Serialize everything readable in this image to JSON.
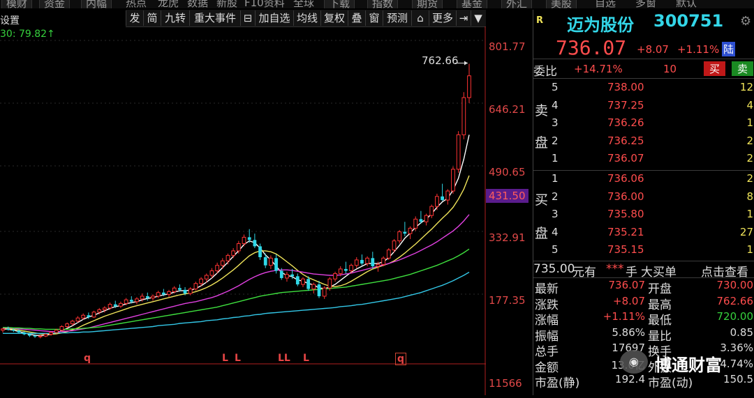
{
  "top_menu": [
    "模财",
    "资金",
    "内幅",
    "热点",
    "龙虎",
    "数据",
    "新股",
    "F10资料",
    "全球",
    "下载",
    "指数",
    "期货",
    "基金",
    "外汇",
    "美股",
    "自选",
    "多窗",
    "默认"
  ],
  "toolbar": {
    "items": [
      "发",
      "简",
      "九转",
      "重大事件",
      "⊟",
      "加自选",
      "均线",
      "复权",
      "叠",
      "窗",
      "预测",
      "⌂",
      "更多",
      "⇥",
      "▼"
    ]
  },
  "chart": {
    "indicator_text": "30: 79.82↑",
    "setting_text": "设置",
    "peak_label": "762.66",
    "axis_labels": [
      "801.77",
      "646.21",
      "490.65",
      "431.50",
      "332.91",
      "177.35",
      "11566"
    ],
    "markers": [
      {
        "text": "q"
      },
      {
        "text": "L"
      },
      {
        "text": "L"
      },
      {
        "text": "LL"
      },
      {
        "text": "L"
      },
      {
        "text": "q"
      }
    ]
  },
  "chart_data": {
    "type": "candlestick",
    "peak": 762.66,
    "current_marker": 431.5,
    "ylim": [
      0,
      801.77
    ],
    "candles": [
      [
        175,
        180,
        170,
        178
      ],
      [
        178,
        183,
        174,
        176
      ],
      [
        176,
        179,
        171,
        174
      ],
      [
        174,
        177,
        168,
        170
      ],
      [
        170,
        172,
        164,
        166
      ],
      [
        166,
        169,
        160,
        163
      ],
      [
        163,
        166,
        158,
        161
      ],
      [
        161,
        164,
        157,
        162
      ],
      [
        162,
        168,
        160,
        166
      ],
      [
        166,
        172,
        163,
        170
      ],
      [
        170,
        178,
        168,
        175
      ],
      [
        175,
        186,
        172,
        183
      ],
      [
        183,
        192,
        180,
        189
      ],
      [
        189,
        198,
        185,
        195
      ],
      [
        195,
        206,
        192,
        202
      ],
      [
        202,
        212,
        198,
        208
      ],
      [
        208,
        214,
        200,
        204
      ],
      [
        204,
        218,
        202,
        215
      ],
      [
        215,
        224,
        210,
        220
      ],
      [
        220,
        228,
        214,
        224
      ],
      [
        224,
        236,
        220,
        232
      ],
      [
        232,
        240,
        224,
        228
      ],
      [
        228,
        238,
        224,
        234
      ],
      [
        234,
        246,
        230,
        242
      ],
      [
        242,
        250,
        234,
        238
      ],
      [
        238,
        248,
        232,
        244
      ],
      [
        244,
        256,
        238,
        250
      ],
      [
        250,
        258,
        240,
        246
      ],
      [
        246,
        254,
        240,
        250
      ],
      [
        250,
        262,
        246,
        258
      ],
      [
        258,
        266,
        250,
        254
      ],
      [
        254,
        264,
        248,
        260
      ],
      [
        260,
        272,
        256,
        268
      ],
      [
        268,
        276,
        260,
        264
      ],
      [
        264,
        270,
        252,
        256
      ],
      [
        256,
        270,
        252,
        266
      ],
      [
        266,
        282,
        262,
        278
      ],
      [
        278,
        292,
        272,
        288
      ],
      [
        288,
        300,
        280,
        296
      ],
      [
        296,
        312,
        290,
        306
      ],
      [
        306,
        324,
        300,
        318
      ],
      [
        318,
        334,
        310,
        328
      ],
      [
        328,
        344,
        320,
        340
      ],
      [
        340,
        356,
        334,
        350
      ],
      [
        350,
        372,
        344,
        366
      ],
      [
        366,
        386,
        360,
        380
      ],
      [
        380,
        398,
        368,
        374
      ],
      [
        374,
        388,
        356,
        360
      ],
      [
        360,
        366,
        330,
        336
      ],
      [
        336,
        344,
        312,
        318
      ],
      [
        318,
        340,
        310,
        334
      ],
      [
        334,
        342,
        300,
        306
      ],
      [
        306,
        312,
        286,
        290
      ],
      [
        290,
        304,
        282,
        298
      ],
      [
        298,
        310,
        288,
        294
      ],
      [
        294,
        300,
        272,
        276
      ],
      [
        276,
        292,
        270,
        288
      ],
      [
        288,
        294,
        262,
        266
      ],
      [
        266,
        280,
        256,
        276
      ],
      [
        276,
        284,
        246,
        250
      ],
      [
        250,
        272,
        244,
        268
      ],
      [
        268,
        292,
        262,
        288
      ],
      [
        288,
        304,
        282,
        300
      ],
      [
        300,
        316,
        294,
        310
      ],
      [
        310,
        326,
        300,
        306
      ],
      [
        306,
        322,
        300,
        318
      ],
      [
        318,
        336,
        312,
        330
      ],
      [
        330,
        342,
        318,
        322
      ],
      [
        322,
        338,
        316,
        334
      ],
      [
        334,
        348,
        310,
        316
      ],
      [
        316,
        326,
        304,
        320
      ],
      [
        320,
        338,
        316,
        334
      ],
      [
        334,
        356,
        330,
        352
      ],
      [
        352,
        376,
        346,
        372
      ],
      [
        372,
        396,
        366,
        392
      ],
      [
        392,
        414,
        382,
        388
      ],
      [
        388,
        404,
        376,
        400
      ],
      [
        400,
        426,
        394,
        420
      ],
      [
        420,
        438,
        410,
        414
      ],
      [
        414,
        432,
        406,
        428
      ],
      [
        428,
        452,
        422,
        448
      ],
      [
        448,
        476,
        440,
        470
      ],
      [
        470,
        498,
        460,
        462
      ],
      [
        462,
        486,
        452,
        482
      ],
      [
        482,
        536,
        476,
        530
      ],
      [
        530,
        614,
        522,
        606
      ],
      [
        606,
        700,
        596,
        688
      ],
      [
        688,
        762.66,
        676,
        736.07
      ]
    ],
    "series": [
      {
        "values": [
          178,
          177,
          175,
          172,
          169,
          166,
          164,
          163,
          164,
          166,
          169,
          174,
          179,
          185,
          192,
          199,
          204,
          208,
          213,
          218,
          223,
          227,
          229,
          233,
          236,
          238,
          242,
          245,
          247,
          250,
          253,
          255,
          259,
          262,
          262,
          263,
          267,
          273,
          281,
          290,
          301,
          313,
          325,
          338,
          350,
          364,
          372,
          368,
          356,
          341,
          330,
          316,
          302,
          296,
          293,
          286,
          283,
          278,
          275,
          268,
          267,
          270,
          276,
          285,
          294,
          303,
          310,
          316,
          322,
          322,
          322,
          326,
          335,
          348,
          362,
          378,
          389,
          402,
          412,
          420,
          432,
          446,
          458,
          466,
          484,
          510,
          552,
          606
        ]
      },
      {
        "values": [
          179,
          178,
          177,
          175,
          173,
          171,
          169,
          167,
          166,
          166,
          167,
          169,
          172,
          176,
          180,
          186,
          191,
          196,
          201,
          206,
          210,
          214,
          218,
          222,
          226,
          229,
          232,
          235,
          238,
          241,
          244,
          247,
          250,
          253,
          255,
          257,
          260,
          264,
          269,
          275,
          282,
          290,
          299,
          308,
          318,
          329,
          339,
          346,
          350,
          350,
          348,
          343,
          335,
          326,
          317,
          307,
          298,
          291,
          286,
          281,
          276,
          272,
          271,
          273,
          277,
          283,
          290,
          297,
          304,
          310,
          314,
          318,
          322,
          328,
          336,
          345,
          355,
          365,
          376,
          387,
          398,
          410,
          422,
          433,
          446,
          464,
          486,
          516
        ]
      },
      {
        "values": [
          180,
          180,
          179,
          178,
          177,
          176,
          175,
          174,
          173,
          172,
          172,
          172,
          173,
          174,
          176,
          178,
          180,
          183,
          186,
          189,
          192,
          195,
          198,
          201,
          204,
          207,
          210,
          213,
          216,
          219,
          222,
          225,
          228,
          231,
          234,
          236,
          238,
          241,
          244,
          247,
          251,
          256,
          261,
          267,
          273,
          280,
          287,
          293,
          298,
          302,
          305,
          307,
          308,
          308,
          307,
          305,
          303,
          301,
          299,
          298,
          297,
          296,
          296,
          297,
          299,
          301,
          304,
          307,
          310,
          313,
          316,
          319,
          322,
          326,
          330,
          335,
          340,
          345,
          351,
          357,
          363,
          370,
          378,
          386,
          394,
          404,
          416,
          430
        ]
      },
      {
        "values": [
          181,
          181,
          180,
          180,
          179,
          179,
          178,
          178,
          177,
          177,
          177,
          177,
          177,
          178,
          178,
          179,
          180,
          181,
          182,
          184,
          186,
          188,
          190,
          192,
          194,
          196,
          198,
          200,
          202,
          204,
          206,
          208,
          210,
          212,
          214,
          216,
          218,
          220,
          222,
          224,
          226,
          229,
          232,
          235,
          238,
          241,
          244,
          247,
          250,
          252,
          254,
          256,
          258,
          259,
          260,
          261,
          262,
          263,
          264,
          265,
          266,
          267,
          268,
          269,
          270,
          272,
          274,
          276,
          278,
          280,
          282,
          284,
          286,
          289,
          292,
          295,
          298,
          302,
          306,
          310,
          314,
          318,
          323,
          328,
          333,
          339,
          346,
          354
        ]
      },
      {
        "values": [
          168,
          168,
          168,
          168,
          168,
          168,
          168,
          168,
          168,
          168,
          169,
          169,
          169,
          170,
          170,
          171,
          171,
          172,
          173,
          174,
          175,
          176,
          177,
          178,
          179,
          180,
          181,
          182,
          183,
          185,
          186,
          187,
          188,
          190,
          191,
          192,
          193,
          194,
          196,
          197,
          198,
          200,
          201,
          203,
          204,
          206,
          207,
          209,
          210,
          212,
          213,
          214,
          215,
          216,
          217,
          218,
          219,
          220,
          221,
          222,
          223,
          224,
          225,
          227,
          228,
          229,
          231,
          232,
          234,
          236,
          238,
          240,
          242,
          244,
          246,
          249,
          252,
          255,
          258,
          262,
          266,
          270,
          274,
          279,
          284,
          290,
          296,
          303
        ]
      }
    ]
  },
  "colors": {
    "up": "#ff3333",
    "down": "#30d8e8",
    "ma": [
      "#ffffff",
      "#f0e45a",
      "#e040e0",
      "#3ee03e",
      "#33c8e8"
    ],
    "axis_red": "#e04848"
  },
  "right_panel": {
    "r_label": "R",
    "stock_name": "迈为股份",
    "stock_code": "300751",
    "price": "736.07",
    "change": "+8.07",
    "change_pct": "+1.11%",
    "market_tag": "陆",
    "weibi_label": "委比",
    "weibi_value": "+14.71%",
    "weicha_value": "10",
    "buy_btn": "买",
    "sell_btn": "卖",
    "sell_label": [
      "卖",
      "盘"
    ],
    "buy_label": [
      "买",
      "盘"
    ],
    "sell_levels": [
      {
        "n": "5",
        "price": "738.00",
        "vol": "12"
      },
      {
        "n": "4",
        "price": "737.25",
        "vol": "4"
      },
      {
        "n": "3",
        "price": "736.26",
        "vol": "1"
      },
      {
        "n": "2",
        "price": "736.25",
        "vol": "2"
      },
      {
        "n": "1",
        "price": "736.07",
        "vol": "2"
      }
    ],
    "buy_levels": [
      {
        "n": "1",
        "price": "736.06",
        "vol": "2"
      },
      {
        "n": "2",
        "price": "736.00",
        "vol": "8"
      },
      {
        "n": "3",
        "price": "735.80",
        "vol": "1"
      },
      {
        "n": "4",
        "price": "735.21",
        "vol": "27"
      },
      {
        "n": "5",
        "price": "735.15",
        "vol": "1"
      }
    ],
    "big_order": {
      "price": "735.00",
      "text1": "元有",
      "stars": "***",
      "text2": "手",
      "text3": "大买单",
      "text4": "点击查看"
    },
    "stats": [
      {
        "l1": "最新",
        "v1": "736.07",
        "l2": "开盘",
        "v2": "730.00"
      },
      {
        "l1": "涨跌",
        "v1": "+8.07",
        "l2": "最高",
        "v2": "762.66"
      },
      {
        "l1": "涨幅",
        "v1": "+1.11%",
        "l2": "最低",
        "v2": "720.00"
      },
      {
        "l1": "振幅",
        "v1": "5.86%",
        "l2": "量比",
        "v2": "0.85"
      },
      {
        "l1": "总手",
        "v1": "17697",
        "l2": "换手",
        "v2": "3.36%"
      },
      {
        "l1": "金额",
        "v1": "13.0亿",
        "l2": "外换",
        "v2": "4.74%"
      },
      {
        "l1": "市盈(静)",
        "v1": "192.4",
        "l2": "市盈(动)",
        "v2": "150.5"
      }
    ]
  },
  "watermark": {
    "text": "博通财富"
  }
}
